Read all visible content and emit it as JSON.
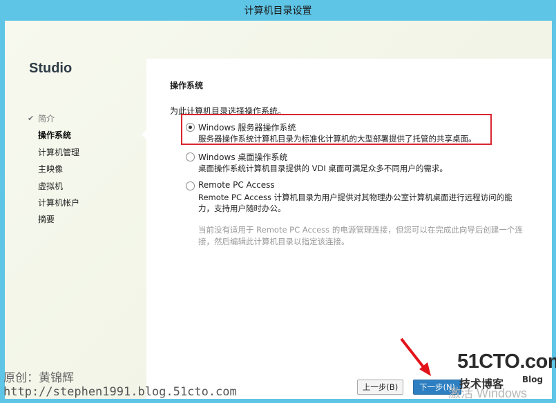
{
  "window": {
    "title": "计算机目录设置"
  },
  "brand": "Studio",
  "nav": {
    "items": [
      {
        "label": "简介",
        "state": "done"
      },
      {
        "label": "操作系统",
        "state": "active"
      },
      {
        "label": "计算机管理",
        "state": "pending"
      },
      {
        "label": "主映像",
        "state": "pending"
      },
      {
        "label": "虚拟机",
        "state": "pending"
      },
      {
        "label": "计算机帐户",
        "state": "pending"
      },
      {
        "label": "摘要",
        "state": "pending"
      }
    ]
  },
  "main": {
    "section_title": "操作系统",
    "intro": "为此计算机目录选择操作系统。",
    "options": [
      {
        "label": "Windows 服务器操作系统",
        "description": "服务器操作系统计算机目录为标准化计算机的大型部署提供了托管的共享桌面。",
        "selected": true
      },
      {
        "label": "Windows 桌面操作系统",
        "description": "桌面操作系统计算机目录提供的 VDI 桌面可满足众多不同用户的需求。",
        "selected": false
      },
      {
        "label": "Remote PC Access",
        "description": "Remote PC Access 计算机目录为用户提供对其物理办公室计算机桌面进行远程访问的能力，支持用户随时办公。",
        "selected": false
      }
    ],
    "note": "当前没有适用于 Remote PC Access 的电源管理连接，但您可以在完成此向导后创建一个连接，然后编辑此计算机目录以指定该连接。"
  },
  "buttons": {
    "back": "上一步(B)",
    "next": "下一步(N)"
  },
  "watermark": {
    "author": "原创：黄锦辉",
    "url": "http://stephen1991.blog.51cto.com",
    "logo": "51CTO.com",
    "logo_sub": "技术博客",
    "logo_blog": "Blog",
    "activate": "激活 Windows"
  },
  "colors": {
    "titlebar": "#5ec5e6",
    "highlight": "#d9262e",
    "next_button": "#2e7fc1"
  }
}
